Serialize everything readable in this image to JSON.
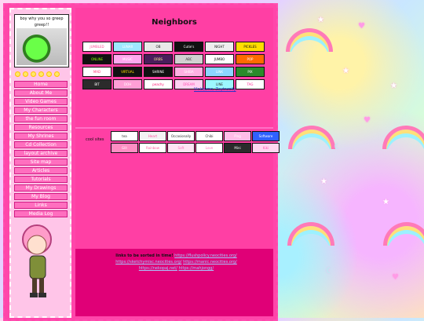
{
  "sidebar": {
    "header_title": "boy why you so greep greep!!",
    "nav_items": [
      "Home",
      "About Me",
      "Video Games",
      "My Characters",
      "the fun room",
      "Resources",
      "My Shrines",
      "Cd Collection",
      "layout archive",
      "Site map",
      "Articles",
      "Tutorials",
      "My Drawings",
      "My Blog",
      "Links",
      "Media Log"
    ]
  },
  "main": {
    "title": "Neighbors",
    "neighbor_names": "Vickkumo, Zaytnzcity",
    "cool_sites_label": "cool sites",
    "footer": {
      "label": "links to be sorted in time!",
      "links": [
        "https://flushpolicy.neocities.org/",
        "https://sketchymisc.neocities.org/",
        "https://manic.neocities.org/",
        "https://nekopaj.net/",
        "https://mahjongg/"
      ]
    }
  },
  "colors": {
    "main_bg": "#ff3fa4",
    "sidebar_bg": "#ffc5e8",
    "nav_button": "#ff6fbf",
    "footer_bg": "#e00077",
    "link_blue": "#2a31c8"
  },
  "buttons": {
    "neighbors": [
      {
        "label": "JUMBLED",
        "bg": "#ffffff",
        "fg": "#ff4f98"
      },
      {
        "label": "LUNAR",
        "bg": "#9ee8ff",
        "fg": "#fff"
      },
      {
        "label": "OB",
        "bg": "#e9e9e9",
        "fg": "#111"
      },
      {
        "label": "Cutie's",
        "bg": "#111111",
        "fg": "#fff"
      },
      {
        "label": "NIGHT",
        "bg": "#eeeeee",
        "fg": "#222"
      },
      {
        "label": "PICKLES",
        "bg": "#ffdd00",
        "fg": "#111"
      },
      {
        "label": "ONLINE",
        "bg": "#111111",
        "fg": "#8fff00"
      },
      {
        "label": "MUSIC",
        "bg": "#ffa8ef",
        "fg": "#fff"
      },
      {
        "label": "ORBS",
        "bg": "#4a1d5c",
        "fg": "#ffeb8f"
      },
      {
        "label": "ABC",
        "bg": "#d1d1d1",
        "fg": "#333"
      },
      {
        "label": "JUMBO",
        "bg": "#ffffff",
        "fg": "#111"
      },
      {
        "label": "POP",
        "bg": "#ff6b00",
        "fg": "#fff"
      },
      {
        "label": "MAD",
        "bg": "#ffffff",
        "fg": "#ff3a78"
      },
      {
        "label": "VIRTUAL",
        "bg": "#111111",
        "fg": "#ffe100"
      },
      {
        "label": "SHRINE",
        "bg": "#111111",
        "fg": "#fff"
      },
      {
        "label": "SHIBA",
        "bg": "#ffb1e2",
        "fg": "#fff"
      },
      {
        "label": "LINK",
        "bg": "#8cd5ff",
        "fg": "#fff"
      },
      {
        "label": "PIX",
        "bg": "#2b8a2b",
        "fg": "#fff"
      },
      {
        "label": "BIT",
        "bg": "#2b2b2b",
        "fg": "#fff"
      },
      {
        "label": "DOH",
        "bg": "#ff9fd6",
        "fg": "#fff"
      },
      {
        "label": "peachy",
        "bg": "#ffffff",
        "fg": "#ff1a75"
      },
      {
        "label": "DREAM",
        "bg": "#ffd2f2",
        "fg": "#ff4bb0"
      },
      {
        "label": "LINE",
        "bg": "#9cf7ff",
        "fg": "#333"
      },
      {
        "label": "TAG",
        "bg": "#ffffff",
        "fg": "#ff2d9b"
      }
    ],
    "cool_sites": [
      {
        "label": "tea",
        "bg": "#ffffff",
        "fg": "#333"
      },
      {
        "label": "Heart",
        "bg": "#f3f3f3",
        "fg": "#ff4b9c"
      },
      {
        "label": "Occasionally",
        "bg": "#ffffff",
        "fg": "#333"
      },
      {
        "label": "Chibi",
        "bg": "#ffffff",
        "fg": "#333"
      },
      {
        "label": "Ping",
        "bg": "#ffbde8",
        "fg": "#fff"
      },
      {
        "label": "Software",
        "bg": "#2f61ff",
        "fg": "#fff"
      },
      {
        "label": "Glit",
        "bg": "#ff8ec3",
        "fg": "#fff"
      },
      {
        "label": "Rainbow",
        "bg": "#ffffff",
        "fg": "#ff5fa0"
      },
      {
        "label": "Soft",
        "bg": "#ffe4f4",
        "fg": "#ff71bd"
      },
      {
        "label": "Love",
        "bg": "#ffffff",
        "fg": "#ff71bd"
      },
      {
        "label": "Mini",
        "bg": "#2b2b2b",
        "fg": "#fff"
      },
      {
        "label": "Kiki",
        "bg": "#ffd6f0",
        "fg": "#ff4bb0"
      }
    ]
  }
}
